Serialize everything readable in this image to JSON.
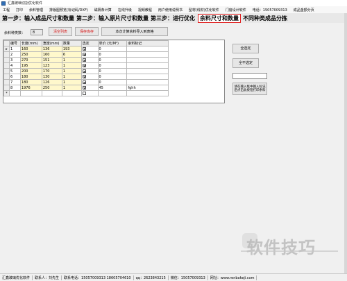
{
  "window": {
    "title": "汇鑫玻璃切割优化软件"
  },
  "menu": [
    "工程",
    "打印",
    "余料管理",
    "排版图预览(标记码/DXF)",
    "磁隔条计算",
    "在线升级",
    "视频教程",
    "用户使用说明书",
    "型材(线材)优化软件",
    "门窗设计软件",
    "电话：15057009313",
    "成品金额分页"
  ],
  "steps": [
    "第一步：输入成品尺寸和数量",
    "第二步：输入原片尺寸和数量",
    "第三步：进行优化",
    "余料尺寸和数量",
    "不同种类成品分拣"
  ],
  "toolbar": {
    "count_label": "余料种类数：",
    "count_value": "8",
    "clear_button": "清空列表",
    "save_button": "保存库存",
    "import_button": "本次计算余料导入到表格"
  },
  "table": {
    "headers": [
      "编号",
      "长度(mm)",
      "宽度(mm)",
      "数量",
      "选定",
      "单价 (元/M²)",
      "余料标记"
    ],
    "rows": [
      {
        "id": "1",
        "length": "160",
        "width": "136",
        "qty": "193",
        "checked": true,
        "price": "0",
        "mark": ""
      },
      {
        "id": "2",
        "length": "250",
        "width": "160",
        "qty": "6",
        "checked": true,
        "price": "0",
        "mark": ""
      },
      {
        "id": "3",
        "length": "270",
        "width": "151",
        "qty": "1",
        "checked": true,
        "price": "0",
        "mark": ""
      },
      {
        "id": "4",
        "length": "195",
        "width": "123",
        "qty": "1",
        "checked": true,
        "price": "0",
        "mark": ""
      },
      {
        "id": "5",
        "length": "200",
        "width": "170",
        "qty": "1",
        "checked": true,
        "price": "0",
        "mark": ""
      },
      {
        "id": "6",
        "length": "180",
        "width": "130",
        "qty": "1",
        "checked": true,
        "price": "0",
        "mark": ""
      },
      {
        "id": "7",
        "length": "180",
        "width": "126",
        "qty": "1",
        "checked": true,
        "price": "0",
        "mark": ""
      },
      {
        "id": "8",
        "length": "1976",
        "width": "250",
        "qty": "1",
        "checked": true,
        "price": "45",
        "mark": "fghh"
      }
    ]
  },
  "side": {
    "select_all": "全选定",
    "deselect_all": "全不选定",
    "search_value": "",
    "tag_button": "请在输入框中输入标记后点击此按钮打印余料"
  },
  "status": [
    "汇鑫玻璃优化软件",
    "联系人：刘先生",
    "联系电话：15057009313 18605704610",
    "qq：2623843215",
    "微信：15057009313",
    "网址：www.renbakeji.com"
  ],
  "watermark": "软件技巧",
  "colors": {
    "active_step_border": "#e02020",
    "red_text": "#d81e1e",
    "input_cell_bg": "#fff8cc"
  }
}
